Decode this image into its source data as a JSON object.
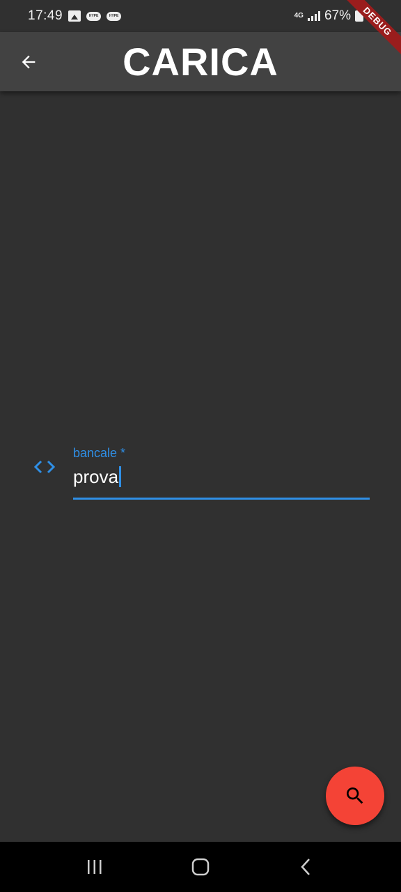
{
  "status_bar": {
    "time": "17:49",
    "notification_icons": [
      "image-icon",
      "hype-icon",
      "hype-icon"
    ],
    "notif_pill_text": "HYPE",
    "network": "4G",
    "battery": "67%"
  },
  "debug_banner": "DEBUG",
  "app_bar": {
    "title": "CARICA",
    "back_icon": "arrow-back-icon"
  },
  "form": {
    "field_icon": "code-icon",
    "label": "bancale *",
    "value": "prova"
  },
  "fab": {
    "icon": "search-icon"
  },
  "nav": {
    "buttons": [
      "recents-icon",
      "home-icon",
      "back-icon"
    ]
  },
  "colors": {
    "background": "#303030",
    "app_bar": "#424242",
    "accent": "#2f8fe6",
    "fab": "#f44336",
    "debug": "#9a1d1d"
  }
}
